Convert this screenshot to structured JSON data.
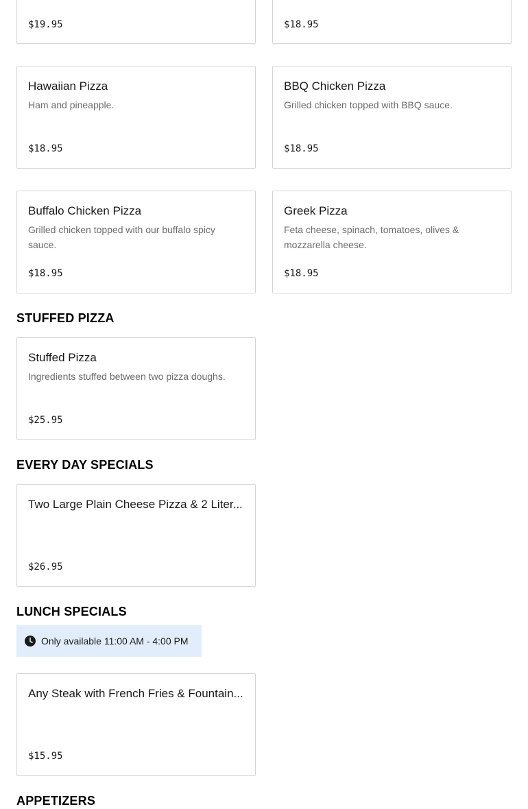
{
  "top_cards": [
    {
      "price": "$19.95"
    },
    {
      "price": "$18.95"
    }
  ],
  "pizzas": [
    {
      "name": "Hawaiian Pizza",
      "description": "Ham and pineapple.",
      "price": "$18.95"
    },
    {
      "name": "BBQ Chicken Pizza",
      "description": "Grilled chicken topped with BBQ sauce.",
      "price": "$18.95"
    },
    {
      "name": "Buffalo Chicken Pizza",
      "description": "Grilled chicken topped with our buffalo spicy sauce.",
      "price": "$18.95"
    },
    {
      "name": "Greek Pizza",
      "description": "Feta cheese, spinach, tomatoes, olives & mozzarella cheese.",
      "price": "$18.95"
    }
  ],
  "stuffed": {
    "title": "STUFFED PIZZA",
    "items": [
      {
        "name": "Stuffed Pizza",
        "description": "Ingredients stuffed between two pizza doughs.",
        "price": "$25.95"
      }
    ]
  },
  "everyday": {
    "title": "EVERY DAY SPECIALS",
    "items": [
      {
        "name": "Two Large Plain Cheese Pizza & 2 Liter...",
        "description": "",
        "price": "$26.95"
      }
    ]
  },
  "lunch": {
    "title": "LUNCH SPECIALS",
    "notice": "Only available 11:00 AM - 4:00 PM",
    "notice_icon": "clock-icon",
    "notice_bg": "#e2edfb",
    "items": [
      {
        "name": "Any Steak with French Fries & Fountain...",
        "description": "",
        "price": "$15.95"
      }
    ]
  },
  "appetizers": {
    "title": "APPETIZERS"
  }
}
